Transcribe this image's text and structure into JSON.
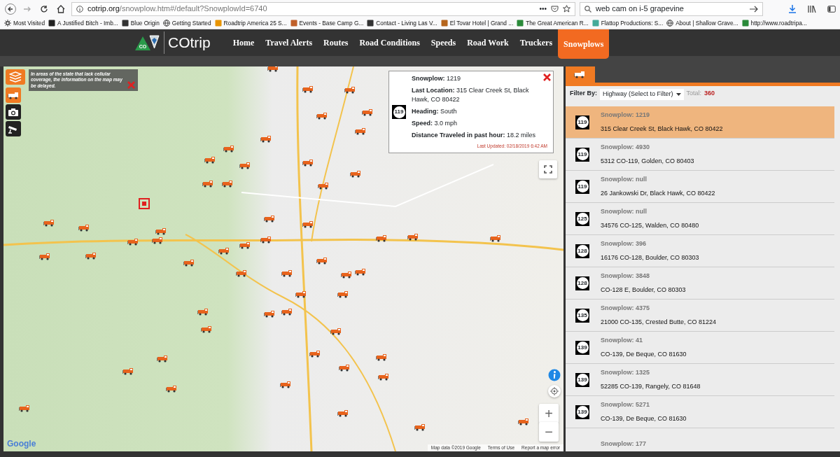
{
  "browser": {
    "url_host": "cotrip.org",
    "url_path": "/snowplow.htm#/default?SnowplowId=6740",
    "more": "•••",
    "search": "web cam on i-5 grapevine",
    "bookmarks": [
      "Most Visited",
      "A Justified Bitch - Imb...",
      "Blue Origin",
      "Getting Started",
      "Roadtrip America 25 S...",
      "Events - Base Camp G...",
      "Contact - Living Las V...",
      "El Tovar Hotel | Grand ...",
      "The Great American R...",
      "Flattop Productions: S...",
      "About | Shallow Grave...",
      "http://www.roadtripa..."
    ]
  },
  "nav": {
    "logo_badge": "CO",
    "logo_text": "COtrip",
    "items": [
      {
        "label": "Home",
        "selected": false
      },
      {
        "label": "Travel Alerts",
        "selected": false
      },
      {
        "label": "Routes",
        "selected": false
      },
      {
        "label": "Road Conditions",
        "selected": false
      },
      {
        "label": "Speeds",
        "selected": false
      },
      {
        "label": "Road Work",
        "selected": false
      },
      {
        "label": "Truckers",
        "selected": false
      },
      {
        "label": "Snowplows",
        "selected": true
      }
    ]
  },
  "map": {
    "notice": "In areas of the state that lack cellular coverage, the information on the map may be delayed.",
    "popup": {
      "shield": "119",
      "fields": [
        "**Snowplow:** 1219",
        "**Last Location:** 315 Clear Creek St, Black Hawk, CO 80422",
        "**Heading:** South",
        "**Speed:** 3.0 mph",
        "**Distance Traveled in past hour:** 18.2 miles"
      ],
      "updated": "Last Updated: 02/18/2019 6:42 AM"
    },
    "zoom_in": "+",
    "zoom_out": "−",
    "logo": "Google",
    "attribution": [
      "Map data ©2019 Google",
      "Terms of Use",
      "Report a map error"
    ]
  },
  "panel": {
    "filter_label": "Filter By:",
    "filter_value": "Highway (Select to Filter)",
    "total_label": "Total:",
    "total": "360",
    "items": [
      {
        "shield": "119",
        "title": "Snowplow: 1219",
        "address": "315 Clear Creek St, Black Hawk, CO 80422",
        "selected": true
      },
      {
        "shield": "119",
        "title": "Snowplow: 4930",
        "address": "5312 CO-119, Golden, CO 80403",
        "selected": false
      },
      {
        "shield": "119",
        "title": "Snowplow: null",
        "address": "26 Jankowski Dr, Black Hawk, CO 80422",
        "selected": false
      },
      {
        "shield": "125",
        "title": "Snowplow: null",
        "address": "34576 CO-125, Walden, CO 80480",
        "selected": false
      },
      {
        "shield": "128",
        "title": "Snowplow: 396",
        "address": "16176 CO-128, Boulder, CO 80303",
        "selected": false
      },
      {
        "shield": "128",
        "title": "Snowplow: 3848",
        "address": "CO-128 E, Boulder, CO 80303",
        "selected": false
      },
      {
        "shield": "135",
        "title": "Snowplow: 4375",
        "address": "21000 CO-135, Crested Butte, CO 81224",
        "selected": false
      },
      {
        "shield": "139",
        "title": "Snowplow: 41",
        "address": "CO-139, De Beque, CO 81630",
        "selected": false
      },
      {
        "shield": "139",
        "title": "Snowplow: 1325",
        "address": "52285 CO-139, Rangely, CO 81648",
        "selected": false
      },
      {
        "shield": "139",
        "title": "Snowplow: 5271",
        "address": "CO-139, De Beque, CO 81630",
        "selected": false
      },
      {
        "title": "Snowplow: 177",
        "selected": false
      }
    ]
  }
}
